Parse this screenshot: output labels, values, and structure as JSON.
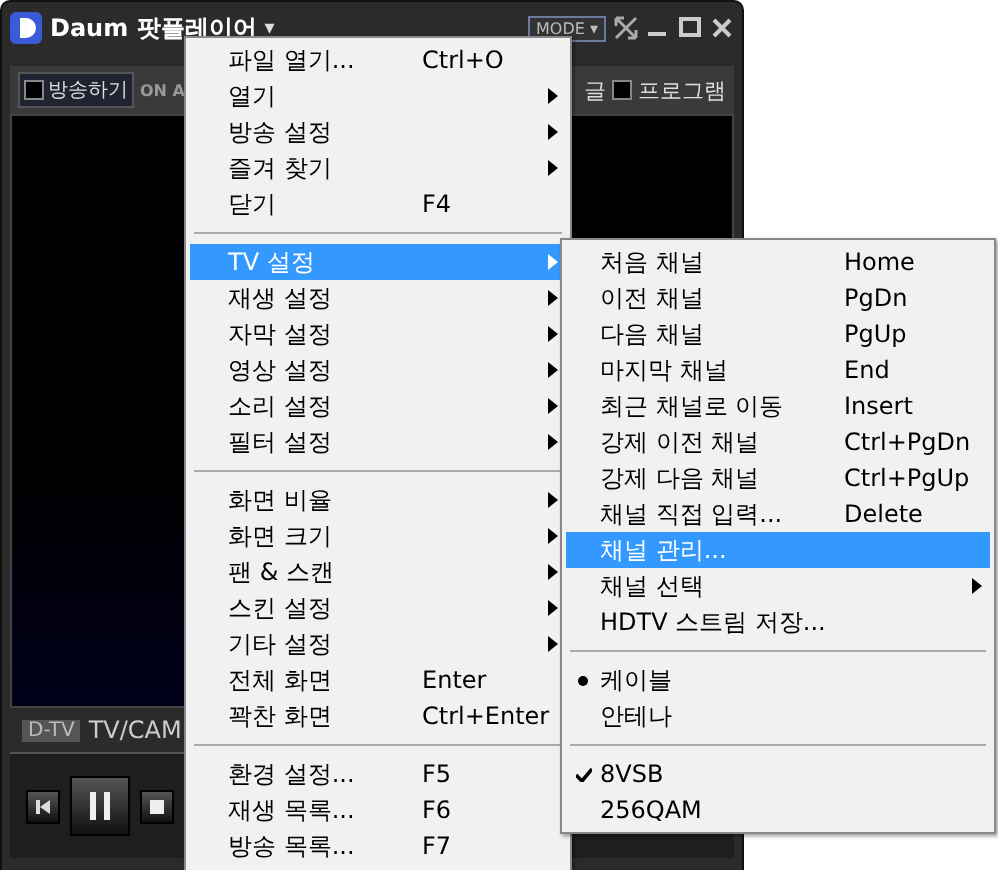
{
  "window": {
    "title": "Daum 팟플레이어",
    "title_caret": "▾",
    "mode_button": "MODE ▾"
  },
  "toolbar": {
    "broadcast": {
      "label": "방송하기",
      "checked": false
    },
    "on_air": "ON A",
    "cut_label": "글",
    "program": {
      "label": "프로그램",
      "checked": false
    }
  },
  "status": {
    "badge": "D-TV",
    "source": "TV/CAM"
  },
  "menu": [
    [
      {
        "label": "파일 열기...",
        "shortcut": "Ctrl+O",
        "submenu": false,
        "selected": false
      },
      {
        "label": "열기",
        "submenu": true,
        "selected": false
      },
      {
        "label": "방송 설정",
        "submenu": true,
        "selected": false
      },
      {
        "label": "즐겨 찾기",
        "submenu": true,
        "selected": false
      },
      {
        "label": "닫기",
        "shortcut": "F4",
        "submenu": false,
        "selected": false
      }
    ],
    [
      {
        "label": "TV 설정",
        "submenu": true,
        "selected": true
      },
      {
        "label": "재생 설정",
        "submenu": true,
        "selected": false
      },
      {
        "label": "자막 설정",
        "submenu": true,
        "selected": false
      },
      {
        "label": "영상 설정",
        "submenu": true,
        "selected": false
      },
      {
        "label": "소리 설정",
        "submenu": true,
        "selected": false
      },
      {
        "label": "필터 설정",
        "submenu": true,
        "selected": false
      }
    ],
    [
      {
        "label": "화면 비율",
        "submenu": true,
        "selected": false
      },
      {
        "label": "화면 크기",
        "submenu": true,
        "selected": false
      },
      {
        "label": "팬 & 스캔",
        "submenu": true,
        "selected": false
      },
      {
        "label": "스킨 설정",
        "submenu": true,
        "selected": false
      },
      {
        "label": "기타 설정",
        "submenu": true,
        "selected": false
      },
      {
        "label": "전체 화면",
        "shortcut": "Enter",
        "submenu": false,
        "selected": false
      },
      {
        "label": "꽉찬 화면",
        "shortcut": "Ctrl+Enter",
        "submenu": false,
        "selected": false
      }
    ],
    [
      {
        "label": "환경 설정...",
        "shortcut": "F5",
        "submenu": false,
        "selected": false
      },
      {
        "label": "재생 목록...",
        "shortcut": "F6",
        "submenu": false,
        "selected": false
      },
      {
        "label": "방송 목록...",
        "shortcut": "F7",
        "submenu": false,
        "selected": false
      }
    ]
  ],
  "submenu": [
    [
      {
        "kind": "plain",
        "label": "처음 채널",
        "shortcut": "Home",
        "submenu": false,
        "selected": false
      },
      {
        "kind": "plain",
        "label": "이전 채널",
        "shortcut": "PgDn",
        "submenu": false,
        "selected": false
      },
      {
        "kind": "plain",
        "label": "다음 채널",
        "shortcut": "PgUp",
        "submenu": false,
        "selected": false
      },
      {
        "kind": "plain",
        "label": "마지막 채널",
        "shortcut": "End",
        "submenu": false,
        "selected": false
      },
      {
        "kind": "plain",
        "label": "최근 채널로 이동",
        "shortcut": "Insert",
        "submenu": false,
        "selected": false
      },
      {
        "kind": "plain",
        "label": "강제 이전 채널",
        "shortcut": "Ctrl+PgDn",
        "submenu": false,
        "selected": false
      },
      {
        "kind": "plain",
        "label": "강제 다음 채널",
        "shortcut": "Ctrl+PgUp",
        "submenu": false,
        "selected": false
      },
      {
        "kind": "plain",
        "label": "채널 직접 입력...",
        "shortcut": "Delete",
        "submenu": false,
        "selected": false
      },
      {
        "kind": "plain",
        "label": "채널 관리...",
        "submenu": false,
        "selected": true
      },
      {
        "kind": "plain",
        "label": "채널 선택",
        "submenu": true,
        "selected": false
      },
      {
        "kind": "plain",
        "label": "HDTV 스트림 저장...",
        "submenu": false,
        "selected": false
      }
    ],
    [
      {
        "kind": "radio",
        "label": "케이블",
        "checked": true,
        "selected": false
      },
      {
        "kind": "radio",
        "label": "안테나",
        "checked": false,
        "selected": false
      }
    ],
    [
      {
        "kind": "check",
        "label": "8VSB",
        "checked": true,
        "selected": false
      },
      {
        "kind": "check",
        "label": "256QAM",
        "checked": false,
        "selected": false
      }
    ]
  ]
}
